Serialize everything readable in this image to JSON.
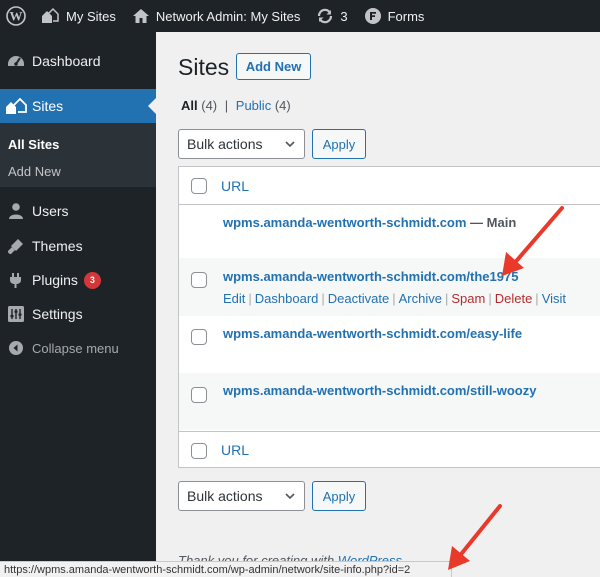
{
  "adminbar": {
    "my_sites": "My Sites",
    "network_admin": "Network Admin: My Sites",
    "updates_count": "3",
    "forms": "Forms"
  },
  "sidebar": {
    "dashboard": "Dashboard",
    "sites": "Sites",
    "sub_all_sites": "All Sites",
    "sub_add_new": "Add New",
    "users": "Users",
    "themes": "Themes",
    "plugins": "Plugins",
    "plugins_badge": "3",
    "settings": "Settings",
    "collapse": "Collapse menu"
  },
  "main": {
    "title": "Sites",
    "add_new": "Add New",
    "filter_all": "All",
    "filter_all_count": "(4)",
    "filter_sep": "|",
    "filter_public": "Public",
    "filter_public_count": "(4)",
    "bulk_actions": "Bulk actions",
    "apply": "Apply",
    "column_url": "URL",
    "main_suffix": "— Main",
    "rows": [
      {
        "url": "wpms.amanda-wentworth-schmidt.com"
      },
      {
        "url": "wpms.amanda-wentworth-schmidt.com/the1975"
      },
      {
        "url": "wpms.amanda-wentworth-schmidt.com/easy-life"
      },
      {
        "url": "wpms.amanda-wentworth-schmidt.com/still-woozy"
      }
    ],
    "row_actions": {
      "edit": "Edit",
      "dashboard": "Dashboard",
      "deactivate": "Deactivate",
      "archive": "Archive",
      "spam": "Spam",
      "delete": "Delete",
      "visit": "Visit",
      "sep": "|"
    },
    "footer_text": "Thank you for creating with",
    "footer_link": "WordPress"
  },
  "statusbar": {
    "url": "https://wpms.amanda-wentworth-schmidt.com/wp-admin/network/site-info.php?id=2"
  },
  "colors": {
    "admin_dark": "#1d2327",
    "accent": "#2271b1",
    "danger": "#b32d2e",
    "annotation_arrow": "#e8392b"
  }
}
